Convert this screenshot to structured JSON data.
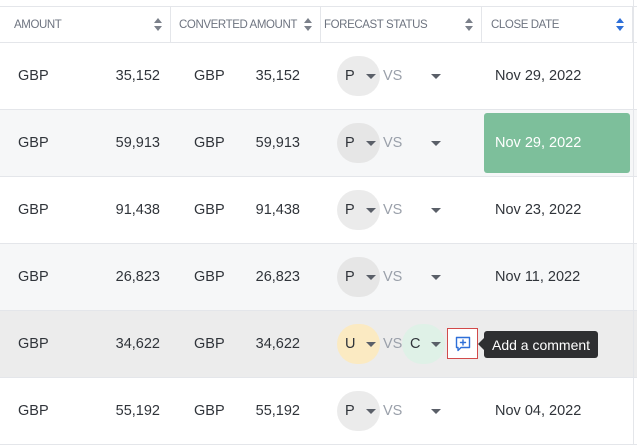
{
  "columns": {
    "amount": "AMOUNT",
    "converted_amount": "CONVERTED AMOUNT",
    "forecast_status": "FORECAST STATUS",
    "close_date": "CLOSE DATE"
  },
  "vs_label": "VS",
  "tooltip": "Add a comment",
  "colors": {
    "highlight_green": "#7dbf9b",
    "status_gray": "#ebebeb",
    "status_yellow": "#fbeac2",
    "status_mint": "#dff1e7",
    "sort_active": "#2e6fd8"
  },
  "rows": [
    {
      "currency": "GBP",
      "amount": "35,152",
      "conv_currency": "GBP",
      "conv_amount": "35,152",
      "status": "P",
      "compare_status": "",
      "close_date": "Nov 29, 2022"
    },
    {
      "currency": "GBP",
      "amount": "59,913",
      "conv_currency": "GBP",
      "conv_amount": "59,913",
      "status": "P",
      "compare_status": "",
      "close_date": "Nov 29, 2022"
    },
    {
      "currency": "GBP",
      "amount": "91,438",
      "conv_currency": "GBP",
      "conv_amount": "91,438",
      "status": "P",
      "compare_status": "",
      "close_date": "Nov 23, 2022"
    },
    {
      "currency": "GBP",
      "amount": "26,823",
      "conv_currency": "GBP",
      "conv_amount": "26,823",
      "status": "P",
      "compare_status": "",
      "close_date": "Nov 11, 2022"
    },
    {
      "currency": "GBP",
      "amount": "34,622",
      "conv_currency": "GBP",
      "conv_amount": "34,622",
      "status": "U",
      "compare_status": "C",
      "close_date": ""
    },
    {
      "currency": "GBP",
      "amount": "55,192",
      "conv_currency": "GBP",
      "conv_amount": "55,192",
      "status": "P",
      "compare_status": "",
      "close_date": "Nov 04, 2022"
    }
  ]
}
